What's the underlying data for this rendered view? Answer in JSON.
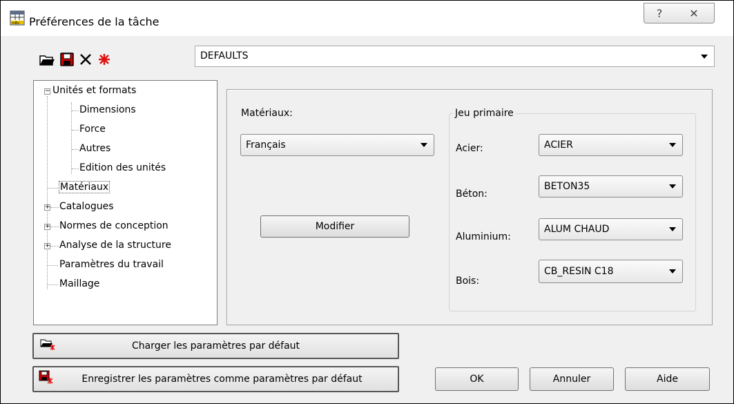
{
  "window": {
    "title": "Préférences de la tâche",
    "help_glyph": "?",
    "close_glyph": "✕"
  },
  "profile_combo": {
    "value": "DEFAULTS"
  },
  "tree": {
    "items": [
      {
        "label": "Unités et formats",
        "expander": "−"
      },
      {
        "label": "Dimensions"
      },
      {
        "label": "Force"
      },
      {
        "label": "Autres"
      },
      {
        "label": "Edition des unités"
      },
      {
        "label": "Matériaux",
        "selected": true
      },
      {
        "label": "Catalogues",
        "expander": "+"
      },
      {
        "label": "Normes de conception",
        "expander": "+"
      },
      {
        "label": "Analyse de la structure",
        "expander": "+"
      },
      {
        "label": "Paramètres du travail"
      },
      {
        "label": "Maillage"
      }
    ]
  },
  "materials": {
    "label": "Matériaux:",
    "database_value": "Français",
    "modify_button": "Modifier"
  },
  "primary_set": {
    "title": "Jeu primaire",
    "rows": [
      {
        "label": "Acier:",
        "value": "ACIER"
      },
      {
        "label": "Béton:",
        "value": "BETON35"
      },
      {
        "label": "Aluminium:",
        "value": "ALUM CHAUD"
      },
      {
        "label": "Bois:",
        "value": "CB_RESIN C18"
      }
    ]
  },
  "bottom": {
    "load_defaults": "Charger les paramètres par défaut",
    "save_defaults": "Enregistrer les paramètres comme paramètres par défaut",
    "ok": "OK",
    "cancel": "Annuler",
    "help": "Aide"
  },
  "icons": {
    "app": "preferences-grid-icon",
    "open": "open-folder-icon",
    "save": "save-disk-icon",
    "delete": "delete-x-icon",
    "reset": "red-star-icon"
  },
  "colors": {
    "accent_red": "#e01010",
    "selection_border": "#555555"
  }
}
